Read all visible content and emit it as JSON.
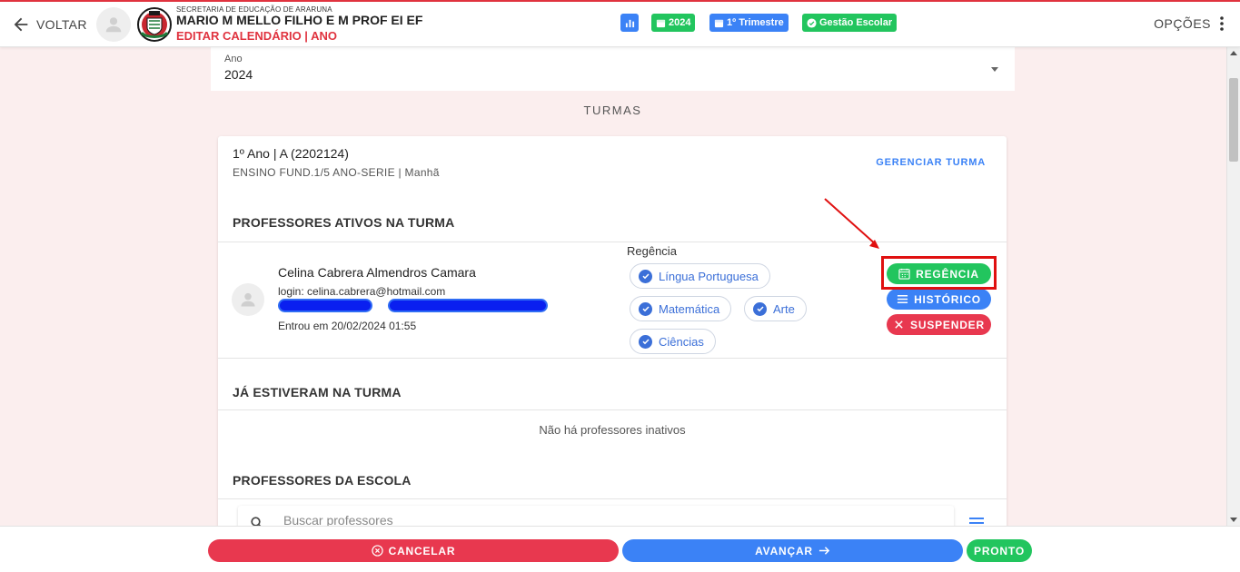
{
  "header": {
    "back_label": "VOLTAR",
    "secretariat": "SECRETARIA DE EDUCAÇÃO DE ARARUNA",
    "school_name": "MARIO M MELLO FILHO E M PROF EI EF",
    "edit_label": "EDITAR CALENDÁRIO | ANO",
    "chip_year": "2024",
    "chip_term": "1º Trimestre",
    "chip_management": "Gestão Escolar",
    "options_label": "OPÇÕES"
  },
  "year_select": {
    "label": "Ano",
    "value": "2024"
  },
  "section_title": "TURMAS",
  "class_card": {
    "title": "1º Ano | A (2202124)",
    "subtitle": "ENSINO FUND.1/5 ANO-SERIE | Manhã",
    "manage_label": "GERENCIAR TURMA",
    "active_header": "PROFESSORES ATIVOS NA TURMA",
    "teacher": {
      "name": "Celina Cabrera Almendros Camara",
      "login": "login: celina.cabrera@hotmail.com",
      "entered": "Entrou em 20/02/2024 01:55"
    },
    "regencia_label": "Regência",
    "subjects": [
      "Língua Portuguesa",
      "Matemática",
      "Arte",
      "Ciências"
    ],
    "actions": {
      "regencia": "REGÊNCIA",
      "historico": "HISTÓRICO",
      "suspender": "SUSPENDER"
    },
    "past_header": "JÁ ESTIVERAM NA TURMA",
    "no_inactive": "Não há professores inativos",
    "school_header": "PROFESSORES DA ESCOLA",
    "search_placeholder": "Buscar professores"
  },
  "footer": {
    "cancel": "CANCELAR",
    "next": "AVANÇAR",
    "done": "PRONTO"
  },
  "colors": {
    "red": "#e8384f",
    "green": "#22c55e",
    "blue": "#3b82f6",
    "annotation": "#e01010"
  }
}
